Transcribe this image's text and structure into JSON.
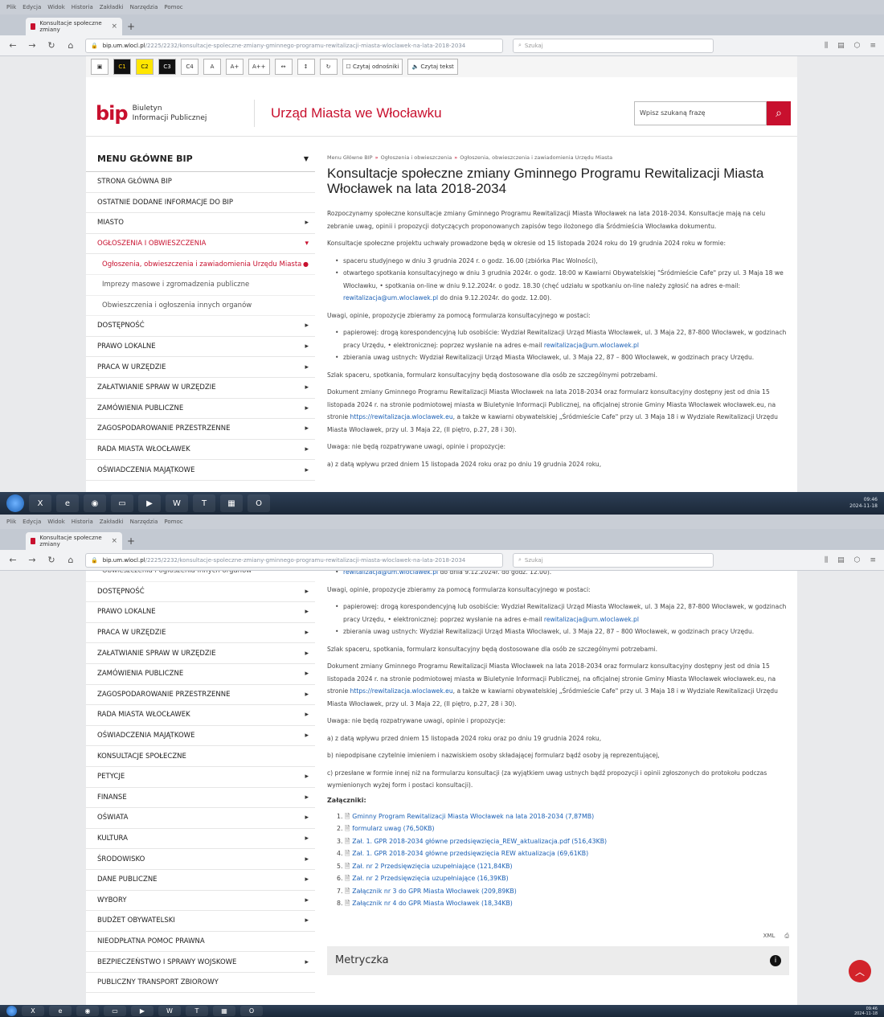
{
  "browser": {
    "menu": [
      "Plik",
      "Edycja",
      "Widok",
      "Historia",
      "Zakładki",
      "Narzędzia",
      "Pomoc"
    ],
    "tab_title": "Konsultacje społeczne zmiany",
    "url_domain": "bip.um.wlocl.pl",
    "url_rest": "/2225/2232/konsultacje-spoleczne-zmiany-gminnego-programu-rewitalizacji-miasta-wloclawek-na-lata-2018-2034",
    "search_placeholder": "Szukaj",
    "search_placeholder_2": "Szukaj"
  },
  "accessibility": {
    "buttons": [
      "C1",
      "C2",
      "C3",
      "C4",
      "A",
      "A+",
      "A++"
    ],
    "read_links": "Czytaj odnośniki",
    "read_text": "Czytaj tekst"
  },
  "header": {
    "logo_mark": "bip",
    "logo_line1": "Biuletyn",
    "logo_line2": "Informacji Publicznej",
    "site_title": "Urząd Miasta we Włocławku",
    "search_placeholder": "Wpisz szukaną frazę"
  },
  "sidebar": {
    "head": "MENU GŁÓWNE BIP",
    "items_top": [
      {
        "label": "STRONA GŁÓWNA BIP",
        "arrow": ""
      },
      {
        "label": "OSTATNIE DODANE INFORMACJE DO BIP",
        "arrow": ""
      },
      {
        "label": "MIASTO",
        "arrow": "▸"
      },
      {
        "label": "OGŁOSZENIA I OBWIESZCZENIA",
        "arrow": "▾"
      }
    ],
    "subitems": [
      "Ogłoszenia, obwieszczenia i zawiadomienia Urzędu Miasta",
      "Imprezy masowe i zgromadzenia publiczne",
      "Obwieszczenia i ogłoszenia innych organów"
    ],
    "items_rest": [
      {
        "label": "DOSTĘPNOŚĆ",
        "arrow": "▸"
      },
      {
        "label": "PRAWO LOKALNE",
        "arrow": "▸"
      },
      {
        "label": "PRACA W URZĘDZIE",
        "arrow": "▸"
      },
      {
        "label": "ZAŁATWIANIE SPRAW W URZĘDZIE",
        "arrow": "▸"
      },
      {
        "label": "ZAMÓWIENIA PUBLICZNE",
        "arrow": "▸"
      },
      {
        "label": "ZAGOSPODAROWANIE PRZESTRZENNE",
        "arrow": "▸"
      },
      {
        "label": "RADA MIASTA WŁOCŁAWEK",
        "arrow": "▸"
      },
      {
        "label": "OŚWIADCZENIA MAJĄTKOWE",
        "arrow": "▸"
      },
      {
        "label": "KONSULTACJE SPOŁECZNE",
        "arrow": ""
      },
      {
        "label": "PETYCJE",
        "arrow": "▸"
      },
      {
        "label": "FINANSE",
        "arrow": "▸"
      },
      {
        "label": "OŚWIATA",
        "arrow": "▸"
      },
      {
        "label": "KULTURA",
        "arrow": "▸"
      },
      {
        "label": "ŚRODOWISKO",
        "arrow": "▸"
      },
      {
        "label": "DANE PUBLICZNE",
        "arrow": "▸"
      },
      {
        "label": "WYBORY",
        "arrow": "▸"
      },
      {
        "label": "BUDŻET OBYWATELSKI",
        "arrow": "▸"
      },
      {
        "label": "NIEODPŁATNA POMOC PRAWNA",
        "arrow": ""
      },
      {
        "label": "BEZPIECZEŃSTWO I SPRAWY WOJSKOWE",
        "arrow": "▸"
      },
      {
        "label": "PUBLICZNY TRANSPORT ZBIOROWY",
        "arrow": ""
      }
    ]
  },
  "content": {
    "crumbs": [
      "Menu Główne BIP",
      "Ogłoszenia i obwieszczenia",
      "Ogłoszenia, obwieszczenia i zawiadomienia Urzędu Miasta"
    ],
    "title": "Konsultacje społeczne zmiany Gminnego Programu Rewitalizacji Miasta Włocławek na lata 2018-2034",
    "p1": "Rozpoczynamy społeczne konsultacje zmiany Gminnego Programu Rewitalizacji Miasta Włocławek na lata 2018-2034. Konsultacje mają na celu zebranie uwag, opinii i propozycji dotyczących proponowanych zapisów tego ilożonego dla Śródmieścia Włocławka dokumentu.",
    "p2": "Konsultacje społeczne projektu uchwały prowadzone będą w okresie od 15 listopada 2024 roku do 19 grudnia 2024 roku w formie:",
    "list1": [
      "spaceru studyjnego w dniu 3 grudnia 2024 r. o godz. 16.00 (zbiórka Plac Wolności),",
      "otwartego spotkania konsultacyjnego w dniu 3 grudnia 2024r. o godz. 18:00 w Kawiarni Obywatelskiej \"Śródmieście Cafe\" przy ul. 3 Maja 18 we Włocławku, • spotkania on-line w dniu 9.12.2024r. o godz. 18.30 (chęć udziału w spotkaniu on-line należy zgłosić na adres e-mail:"
    ],
    "email": "rewitalizacja@um.wloclawek.pl",
    "list1_tail": " do dnia 9.12.2024r. do godz. 12.00).",
    "p3": "Uwagi, opinie, propozycje zbieramy za pomocą formularza konsultacyjnego w postaci:",
    "list2_a": "papierowej: drogą korespondencyjną lub osobiście: Wydział Rewitalizacji Urząd Miasta Włocławek, ul. 3 Maja 22, 87-800 Włocławek, w godzinach pracy Urzędu, • elektronicznej: poprzez wysłanie na adres e-mail ",
    "list2_b": "zbierania uwag ustnych: Wydział Rewitalizacji Urząd Miasta Włocławek, ul. 3 Maja 22, 87 – 800 Włocławek, w godzinach pracy Urzędu.",
    "p4": "Szlak spaceru, spotkania, formularz konsultacyjny będą dostosowane dla osób ze szczególnymi potrzebami.",
    "p5_a": "Dokument zmiany Gminnego Programu Rewitalizacji Miasta Włocławek na lata 2018-2034 oraz formularz konsultacyjny dostępny jest od dnia 15 listopada 2024 r. na stronie podmiotowej miasta w Biuletynie Informacji Publicznej, na oficjalnej stronie Gminy Miasta Włocławek włocławek.eu, na stronie ",
    "p5_link": "https://rewitalizacja.wloclawek.eu",
    "p5_b": ", a także w kawiarni obywatelskiej „Śródmieście Cafe\" przy ul. 3 Maja 18 i w Wydziale Rewitalizacji Urzędu Miasta Włocławek, przy ul. 3 Maja 22, (II piętro, p.27, 28 i 30).",
    "p6": "Uwaga: nie będą rozpatrywane uwagi, opinie i propozycje:",
    "pa": "a) z datą wpływu przed dniem 15 listopada 2024 roku oraz po dniu 19 grudnia 2024 roku,",
    "pb": "b) niepodpisane czytelnie imieniem i nazwiskiem osoby składającej formularz bądź osoby ją reprezentującej,",
    "pc": "c) przesłane w formie innej niż na formularzu konsultacji (za wyjątkiem uwag ustnych bądź propozycji i opinii zgłoszonych do protokołu podczas wymienionych wyżej form i postaci konsultacji).",
    "att_title": "Załączniki:",
    "attachments": [
      "Gminny Program Rewitalizacji Miasta Włocławek na lata 2018-2034 (7,87MB)",
      "formularz uwag (76,50KB)",
      "Zał. 1. GPR 2018-2034 główne przedsięwzięcia_REW_aktualizacja.pdf (516,43KB)",
      "Zał. 1. GPR 2018-2034 główne przedsięwzięcia REW aktualizacja (69,61KB)",
      "Zał. nr 2 Przedsięwzięcia uzupełniające (121,84KB)",
      "Zał. nr 2 Przedsięwzięcia uzupełniające (16,39KB)",
      "Załącznik nr 3 do GPR Miasta Włocławek (209,89KB)",
      "Załącznik nr 4 do GPR Miasta Włocławek (18,34KB)"
    ],
    "xml": "XML",
    "metryczka": "Metryczka"
  },
  "taskbar": {
    "time": "09:46",
    "date": "2024-11-18"
  }
}
